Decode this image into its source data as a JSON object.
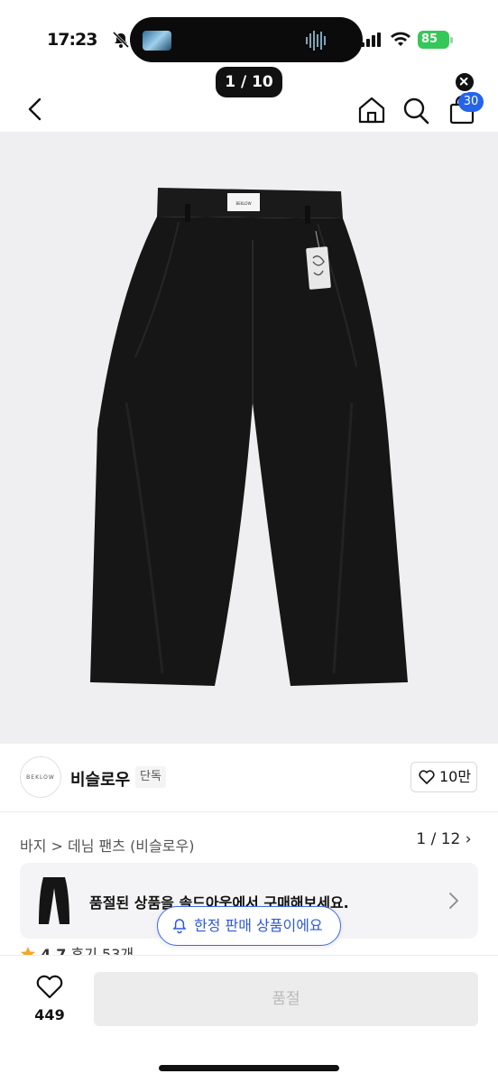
{
  "status_bar": {
    "time": "17:23",
    "battery": "85"
  },
  "top_counter": "1 / 10",
  "nav": {
    "cart_badge": "30"
  },
  "hero": {
    "counter": "1 / 12",
    "label_tag_text": "BEKLOW"
  },
  "brand": {
    "logo_text": "BEKLOW",
    "name": "비슬로우",
    "tag": "단독",
    "likes": "10만"
  },
  "breadcrumb": "바지 > 데님 팬츠 (비슬로우)",
  "soldout_card": {
    "text": "품절된 상품을 솔드아웃에서 구매해보세요."
  },
  "rating": {
    "score": "4.7",
    "reviews": "후기 53개"
  },
  "toast": "한정 판매 상품이에요",
  "bottom": {
    "wish_count": "449",
    "buy_label": "품절"
  },
  "colors": {
    "accent_blue": "#2d5ad8",
    "badge_blue": "#2563eb",
    "battery_green": "#36c759",
    "hero_bg": "#efeff1"
  }
}
